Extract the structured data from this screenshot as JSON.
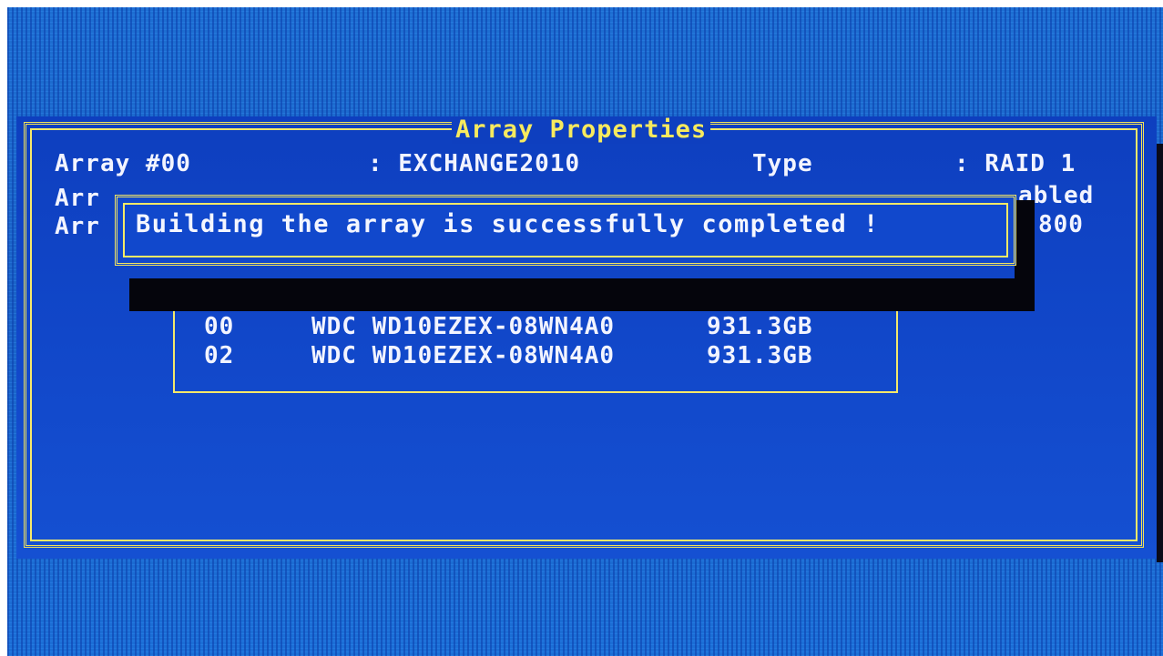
{
  "dialog": {
    "title": "Array Properties",
    "array_number_label": "Array #00",
    "array_name": ": EXCHANGE2010",
    "type_label": "Type",
    "type_value": ": RAID 1",
    "row2_left_fragment": "Arr",
    "row2_right_fragment": "abled",
    "row3_left_fragment": "Arr",
    "row3_right_fragment": "800"
  },
  "drives": [
    {
      "port": "00",
      "model": "WDC WD10EZEX-08WN4A0",
      "capacity": "931.3GB"
    },
    {
      "port": "02",
      "model": "WDC WD10EZEX-08WN4A0",
      "capacity": "931.3GB"
    }
  ],
  "popup": {
    "message": "Building the array is successfully completed !"
  },
  "colors": {
    "screen_blue": "#1a7ad6",
    "panel_blue": "#0e3fbf",
    "frame_yellow": "#f2e25a",
    "text_white": "#f2f4ff"
  }
}
